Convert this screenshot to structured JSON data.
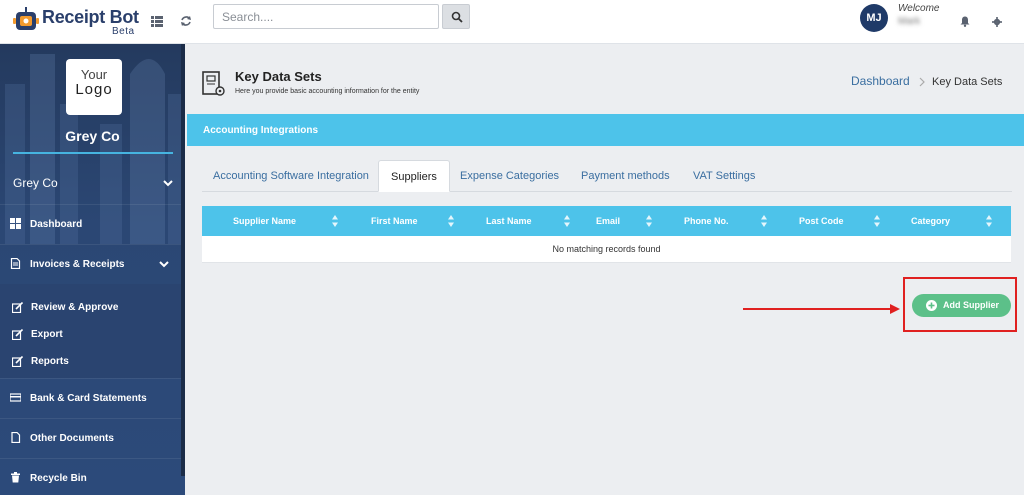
{
  "app": {
    "brand_name": "Receipt Bot",
    "brand_sub": "Beta"
  },
  "topbar": {
    "search_placeholder": "Search....",
    "avatar_initials": "MJ",
    "welcome_label": "Welcome",
    "username": "Mark"
  },
  "sidebar": {
    "logo_line1": "Your",
    "logo_line2": "Logo",
    "company_name": "Grey Co",
    "entity_selector": "Grey Co",
    "items": [
      {
        "label": "Dashboard"
      },
      {
        "label": "Invoices & Receipts"
      },
      {
        "label": "Bank & Card Statements"
      },
      {
        "label": "Other Documents"
      },
      {
        "label": "Recycle Bin"
      }
    ],
    "sub_items": [
      {
        "label": "Review & Approve"
      },
      {
        "label": "Export"
      },
      {
        "label": "Reports"
      }
    ]
  },
  "page": {
    "title": "Key Data Sets",
    "subtitle": "Here you provide basic accounting information for the entity",
    "breadcrumb_home": "Dashboard",
    "breadcrumb_current": "Key Data Sets"
  },
  "panel": {
    "title": "Accounting Integrations",
    "tabs": [
      {
        "label": "Accounting Software Integration",
        "active": false
      },
      {
        "label": "Suppliers",
        "active": true
      },
      {
        "label": "Expense Categories",
        "active": false
      },
      {
        "label": "Payment methods",
        "active": false
      },
      {
        "label": "VAT Settings",
        "active": false
      }
    ]
  },
  "table": {
    "columns": [
      "Supplier Name",
      "First Name",
      "Last Name",
      "Email",
      "Phone No.",
      "Post Code",
      "Category"
    ],
    "empty_message": "No matching records found"
  },
  "actions": {
    "add_supplier": "Add Supplier"
  },
  "colors": {
    "sidebar": "#2b4774",
    "header_accent": "#4dc3ea",
    "add_button": "#5cc089",
    "highlight": "#e02020",
    "link": "#3a6ea0"
  }
}
